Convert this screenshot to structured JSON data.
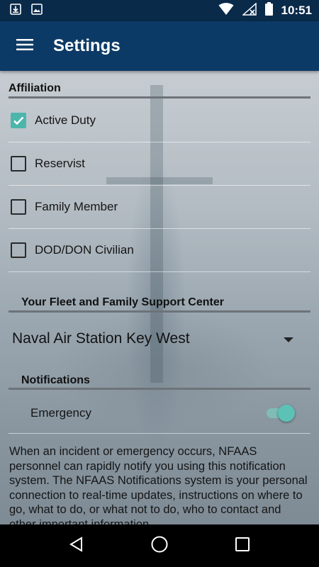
{
  "status_bar": {
    "time": "10:51",
    "icons": [
      "download-icon",
      "image-icon",
      "wifi-icon",
      "no-signal-icon",
      "battery-icon"
    ]
  },
  "app_bar": {
    "title": "Settings",
    "menu_icon": "hamburger-menu-icon"
  },
  "affiliation": {
    "header": "Affiliation",
    "options": [
      {
        "label": "Active Duty",
        "checked": true
      },
      {
        "label": "Reservist",
        "checked": false
      },
      {
        "label": "Family Member",
        "checked": false
      },
      {
        "label": "DOD/DON Civilian",
        "checked": false
      }
    ]
  },
  "support_center": {
    "header": "Your Fleet and Family Support Center",
    "selected": "Naval Air Station Key West"
  },
  "notifications": {
    "header": "Notifications",
    "emergency_label": "Emergency",
    "emergency_enabled": true,
    "description": "When an incident or emergency occurs, NFAAS personnel can rapidly notify you using this notification system. The NFAAS Notifications system is your personal connection to real-time updates, instructions on where to go, what to do, or what not to do, who to contact and other important information."
  },
  "colors": {
    "primary": "#0c3a66",
    "status_bar": "#0a2a4a",
    "accent": "#4db6ac"
  },
  "nav_bar": {
    "icons": [
      "back-icon",
      "home-icon",
      "recents-icon"
    ]
  }
}
